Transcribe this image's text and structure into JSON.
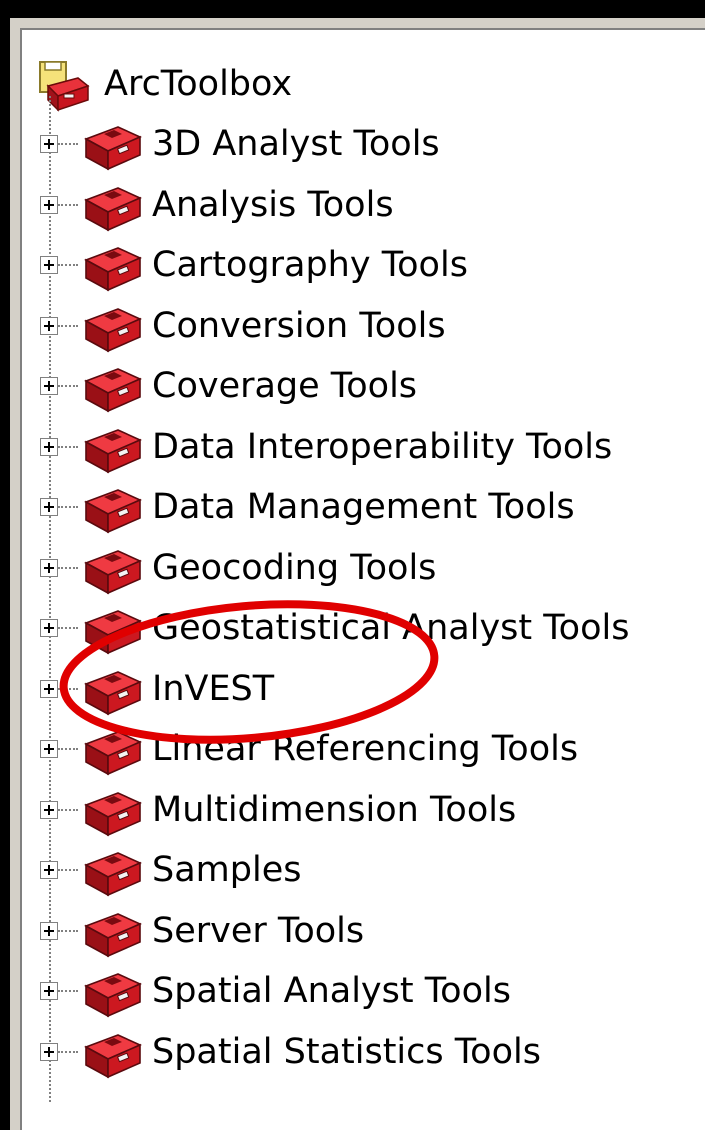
{
  "tree": {
    "root": {
      "label": "ArcToolbox",
      "icon": "arctoolbox-icon"
    },
    "items": [
      {
        "label": "3D Analyst Tools",
        "icon": "toolbox-icon"
      },
      {
        "label": "Analysis Tools",
        "icon": "toolbox-icon"
      },
      {
        "label": "Cartography Tools",
        "icon": "toolbox-icon"
      },
      {
        "label": "Conversion Tools",
        "icon": "toolbox-icon"
      },
      {
        "label": "Coverage Tools",
        "icon": "toolbox-icon"
      },
      {
        "label": "Data Interoperability Tools",
        "icon": "toolbox-icon"
      },
      {
        "label": "Data Management Tools",
        "icon": "toolbox-icon"
      },
      {
        "label": "Geocoding Tools",
        "icon": "toolbox-icon"
      },
      {
        "label": "Geostatistical Analyst Tools",
        "icon": "toolbox-icon"
      },
      {
        "label": "InVEST",
        "icon": "toolbox-icon"
      },
      {
        "label": "Linear Referencing Tools",
        "icon": "toolbox-icon"
      },
      {
        "label": "Multidimension Tools",
        "icon": "toolbox-icon"
      },
      {
        "label": "Samples",
        "icon": "toolbox-icon"
      },
      {
        "label": "Server Tools",
        "icon": "toolbox-icon"
      },
      {
        "label": "Spatial Analyst Tools",
        "icon": "toolbox-icon"
      },
      {
        "label": "Spatial Statistics Tools",
        "icon": "toolbox-icon"
      }
    ]
  },
  "annotation": {
    "highlight_color": "#e00000",
    "highlighted_item": "InVEST"
  }
}
